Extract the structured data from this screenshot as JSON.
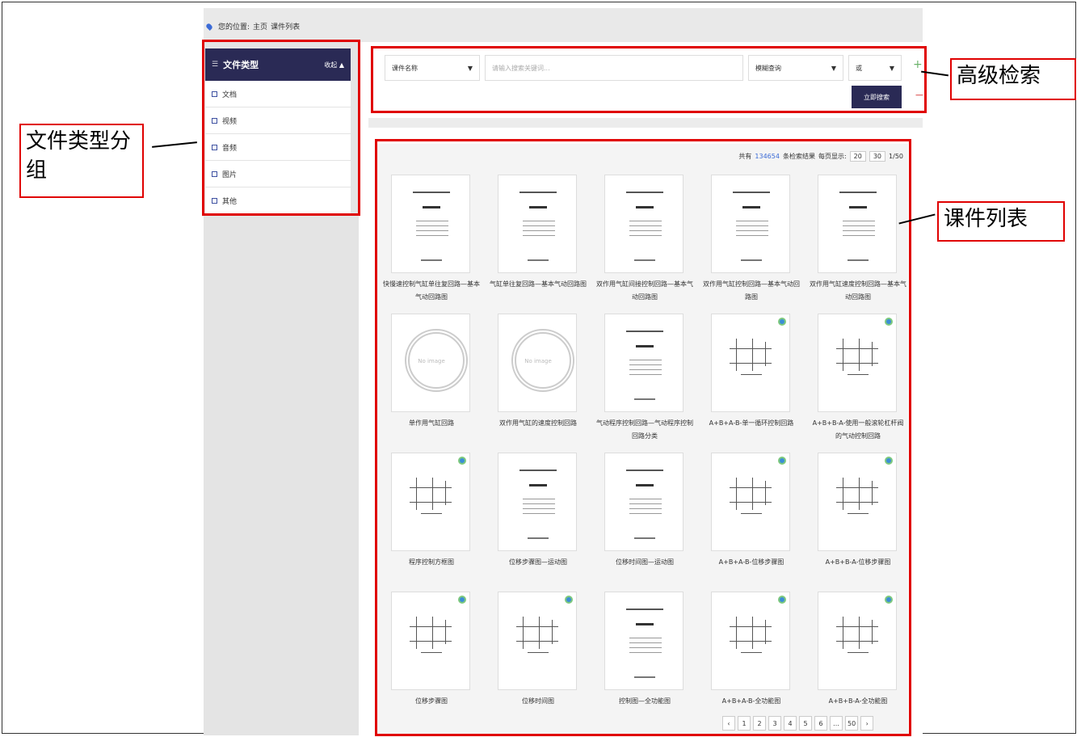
{
  "breadcrumb": {
    "prefix": "您的位置:",
    "home": "主页",
    "current": "课件列表"
  },
  "sidebar": {
    "title": "文件类型",
    "collapse_label": "收起 ▲",
    "items": [
      {
        "label": "文档"
      },
      {
        "label": "视频"
      },
      {
        "label": "音频"
      },
      {
        "label": "图片"
      },
      {
        "label": "其他"
      }
    ]
  },
  "search": {
    "field_select": "课件名称",
    "keyword_placeholder": "请输入搜索关键词...",
    "match_select": "模糊查询",
    "logic_select": "或",
    "submit_label": "立即搜索",
    "add_label": "+",
    "remove_label": "−"
  },
  "list": {
    "total_prefix": "共有",
    "total_count": "134654",
    "total_suffix": "条检索结果",
    "per_page_label": "每页显示:",
    "per_page_options": [
      "20",
      "30"
    ],
    "page_indicator": "1/50",
    "items": [
      {
        "title": "快慢速控制气缸单往复回路—基本气动回路图",
        "thumb": "doc"
      },
      {
        "title": "气缸单往复回路—基本气动回路图",
        "thumb": "doc"
      },
      {
        "title": "双作用气缸间接控制回路—基本气动回路图",
        "thumb": "doc"
      },
      {
        "title": "双作用气缸控制回路—基本气动回路图",
        "thumb": "doc"
      },
      {
        "title": "双作用气缸速度控制回路—基本气动回路图",
        "thumb": "doc"
      },
      {
        "title": "单作用气缸回路",
        "thumb": "noimg"
      },
      {
        "title": "双作用气缸的速度控制回路",
        "thumb": "noimg"
      },
      {
        "title": "气动程序控制回路—气动程序控制回路分类",
        "thumb": "doc"
      },
      {
        "title": "A+B+A-B-单一循环控制回路",
        "thumb": "diagram"
      },
      {
        "title": "A+B+B-A-使用一般滚轮杠杆阀的气动控制回路",
        "thumb": "diagram"
      },
      {
        "title": "程序控制方框图",
        "thumb": "diagram"
      },
      {
        "title": "位移步骤图—运动图",
        "thumb": "doc"
      },
      {
        "title": "位移时间图—运动图",
        "thumb": "doc"
      },
      {
        "title": "A+B+A-B-位移步骤图",
        "thumb": "diagram"
      },
      {
        "title": "A+B+B-A-位移步骤图",
        "thumb": "diagram"
      },
      {
        "title": "位移步骤图",
        "thumb": "diagram"
      },
      {
        "title": "位移时间图",
        "thumb": "diagram"
      },
      {
        "title": "控制图—全功能图",
        "thumb": "doc"
      },
      {
        "title": "A+B+A-B-全功能图",
        "thumb": "diagram"
      },
      {
        "title": "A+B+B-A-全功能图",
        "thumb": "diagram"
      }
    ],
    "noimg_text": "No image",
    "pager": [
      "‹",
      "1",
      "2",
      "3",
      "4",
      "5",
      "6",
      "…",
      "50",
      "›"
    ]
  },
  "annotations": {
    "sidebar_callout": "文件类型分组",
    "search_callout": "高级检索",
    "list_callout": "课件列表"
  },
  "colors": {
    "accent": "#2a2a55",
    "highlight": "#e00000"
  }
}
